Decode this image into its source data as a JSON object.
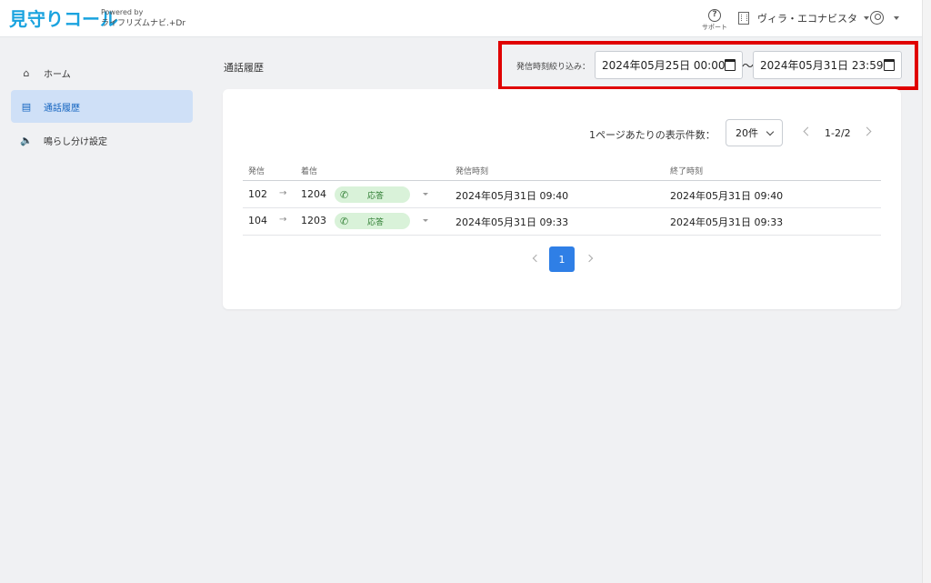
{
  "header": {
    "logo": "見守りコール",
    "powered_by": "Powered by",
    "powered_sub": "ライフリズムナビ.+Dr",
    "support_label": "サポート",
    "support_glyph": "?",
    "org_name": "ヴィラ・エコナビスタ"
  },
  "sidebar": {
    "items": [
      {
        "label": "ホーム",
        "icon": "home-icon",
        "glyph": "⌂"
      },
      {
        "label": "通話履歴",
        "icon": "document-icon",
        "glyph": "▤",
        "active": true
      },
      {
        "label": "鳴らし分け設定",
        "icon": "speaker-icon",
        "glyph": "🔈"
      }
    ]
  },
  "main": {
    "title": "通話履歴",
    "filter": {
      "label": "発信時刻絞り込み：",
      "start": "2024年05月25日 00:00",
      "separator": "〜",
      "end": "2024年05月31日 23:59"
    },
    "pagination": {
      "per_page_label": "1ページあたりの表示件数：",
      "per_page_value": "20件",
      "range": "1-2/2",
      "current_page": "1"
    },
    "table": {
      "headers": [
        "発信",
        "着信",
        "発信時刻",
        "終了時刻"
      ],
      "rows": [
        {
          "from": "102",
          "to": "1204",
          "status": "応答",
          "start": "2024年05月31日 09:40",
          "end": "2024年05月31日 09:40"
        },
        {
          "from": "104",
          "to": "1203",
          "status": "応答",
          "start": "2024年05月31日 09:33",
          "end": "2024年05月31日 09:33"
        }
      ]
    },
    "status_color": "#2e7d32",
    "accent_color": "#2f7fe6",
    "highlight_color": "#e00000"
  }
}
